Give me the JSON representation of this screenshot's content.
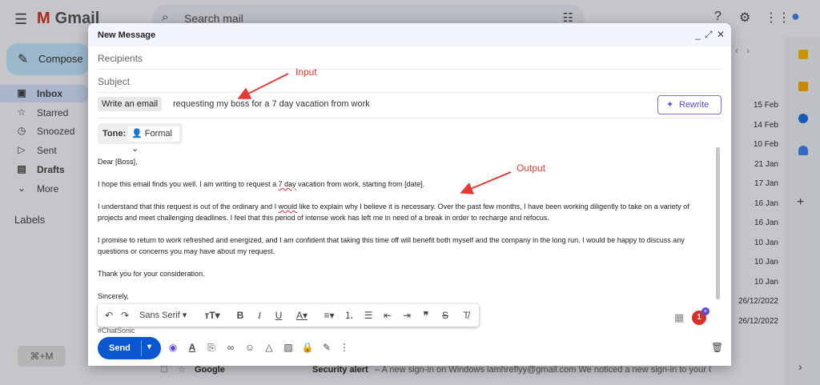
{
  "gmail": {
    "logo": "Gmail",
    "search_placeholder": "Search mail",
    "compose_label": "Compose",
    "nav": [
      {
        "icon": "inbox-icon",
        "label": "Inbox"
      },
      {
        "icon": "star-icon",
        "label": "Starred"
      },
      {
        "icon": "clock-icon",
        "label": "Snoozed"
      },
      {
        "icon": "send-icon",
        "label": "Sent"
      },
      {
        "icon": "file-icon",
        "label": "Drafts"
      },
      {
        "icon": "chevron-down-icon",
        "label": "More"
      }
    ],
    "labels_heading": "Labels",
    "shortcut": "⌘+M",
    "dates": [
      "15 Feb",
      "14 Feb",
      "10 Feb",
      "21 Jan",
      "17 Jan",
      "16 Jan",
      "16 Jan",
      "10 Jan",
      "10 Jan",
      "10 Jan",
      "26/12/2022",
      "26/12/2022"
    ],
    "bottom_row": {
      "sender": "Google",
      "subject": "Security alert",
      "snippet": "– A new sign-in on Windows iamhreflyy@gmail.com We noticed a new sign-in to your Goo..."
    }
  },
  "compose": {
    "title": "New Message",
    "recipients_placeholder": "Recipients",
    "subject_placeholder": "Subject",
    "ai_chip": "Write an email",
    "ai_prompt": "requesting my boss for a 7 day vacation from work",
    "rewrite_label": "Rewrite",
    "tone_label": "Tone:",
    "tone_value": "Formal",
    "body": {
      "greeting": "Dear [Boss],",
      "p1_pre": "I hope this email finds you well. I am writing to request a ",
      "p1_mark": "7 day",
      "p1_post": " vacation from work, starting from [date].",
      "p2_pre": "I understand that this request is out of the ordinary and I ",
      "p2_mark": "would",
      "p2_post": " like to explain why I believe it is necessary. Over the past few months, I have been working diligently to take on a variety of projects and meet challenging deadlines. I feel that this period of intense work has left me in need of a break in order to recharge and refocus.",
      "p3": "I promise to return to work refreshed and energized, and I am confident that taking this time off will benefit both myself and the company in the long run. I would be happy to discuss any questions or concerns you may have about my request.",
      "p4": "Thank you for your consideration.",
      "closing": "Sincerely,",
      "signature": "#ChatSonic"
    },
    "toolbar": {
      "font": "Sans Serif"
    },
    "send_label": "Send",
    "notification_count": "1"
  },
  "annotations": {
    "input": "Input",
    "output": "Output"
  },
  "colors": {
    "accent": "#0b57d0",
    "annotation": "#e53935",
    "rewrite": "#5b4ae0"
  }
}
